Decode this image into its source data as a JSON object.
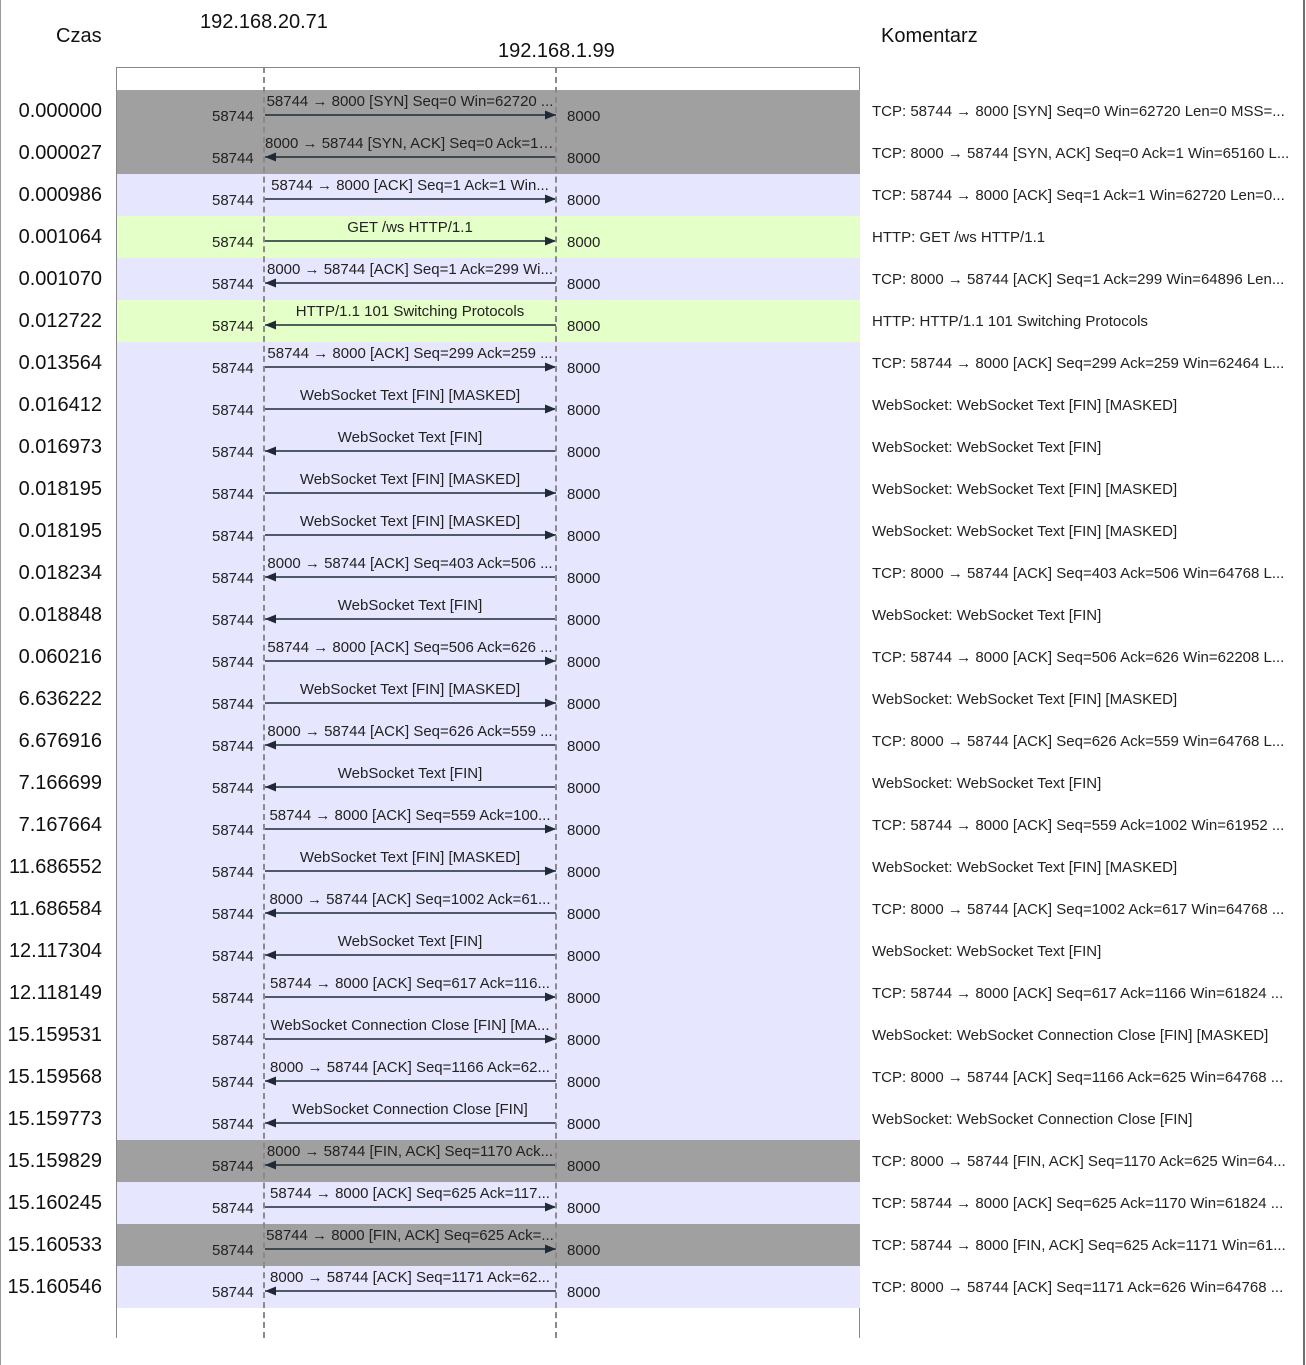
{
  "headers": {
    "time": "Czas",
    "host_a": "192.168.20.71",
    "host_b": "192.168.1.99",
    "comment": "Komentarz"
  },
  "colors": {
    "tcp_handshake": "#a0a0a0",
    "tcp": "#e7e6ff",
    "http": "#e4ffc7",
    "websocket": "#e7e6ff"
  },
  "rows": [
    {
      "time": "0.000000",
      "port_a": "58744",
      "port_b": "8000",
      "dir": "right",
      "label": "58744 → 8000 [SYN] Seq=0 Win=62720 ...",
      "comment": "TCP: 58744 → 8000 [SYN] Seq=0 Win=62720 Len=0 MSS=...",
      "color": "#a0a0a0"
    },
    {
      "time": "0.000027",
      "port_a": "58744",
      "port_b": "8000",
      "dir": "left",
      "label": "8000 → 58744 [SYN, ACK] Seq=0 Ack=1 ...",
      "comment": "TCP: 8000 → 58744 [SYN, ACK] Seq=0 Ack=1 Win=65160 L...",
      "color": "#a0a0a0"
    },
    {
      "time": "0.000986",
      "port_a": "58744",
      "port_b": "8000",
      "dir": "right",
      "label": "58744 → 8000 [ACK] Seq=1 Ack=1 Win...",
      "comment": "TCP: 58744 → 8000 [ACK] Seq=1 Ack=1 Win=62720 Len=0...",
      "color": "#e7e6ff"
    },
    {
      "time": "0.001064",
      "port_a": "58744",
      "port_b": "8000",
      "dir": "right",
      "label": "GET /ws HTTP/1.1",
      "comment": "HTTP: GET /ws HTTP/1.1",
      "color": "#e4ffc7"
    },
    {
      "time": "0.001070",
      "port_a": "58744",
      "port_b": "8000",
      "dir": "left",
      "label": "8000 → 58744 [ACK] Seq=1 Ack=299 Wi...",
      "comment": "TCP: 8000 → 58744 [ACK] Seq=1 Ack=299 Win=64896 Len...",
      "color": "#e7e6ff"
    },
    {
      "time": "0.012722",
      "port_a": "58744",
      "port_b": "8000",
      "dir": "left",
      "label": "HTTP/1.1 101 Switching Protocols",
      "comment": "HTTP: HTTP/1.1 101 Switching Protocols",
      "color": "#e4ffc7"
    },
    {
      "time": "0.013564",
      "port_a": "58744",
      "port_b": "8000",
      "dir": "right",
      "label": "58744 → 8000 [ACK] Seq=299 Ack=259 ...",
      "comment": "TCP: 58744 → 8000 [ACK] Seq=299 Ack=259 Win=62464 L...",
      "color": "#e7e6ff"
    },
    {
      "time": "0.016412",
      "port_a": "58744",
      "port_b": "8000",
      "dir": "right",
      "label": "WebSocket Text [FIN] [MASKED]",
      "comment": "WebSocket: WebSocket Text [FIN] [MASKED]",
      "color": "#e7e6ff"
    },
    {
      "time": "0.016973",
      "port_a": "58744",
      "port_b": "8000",
      "dir": "left",
      "label": "WebSocket Text [FIN]",
      "comment": "WebSocket: WebSocket Text [FIN]",
      "color": "#e7e6ff"
    },
    {
      "time": "0.018195",
      "port_a": "58744",
      "port_b": "8000",
      "dir": "right",
      "label": "WebSocket Text [FIN] [MASKED]",
      "comment": "WebSocket: WebSocket Text [FIN] [MASKED]",
      "color": "#e7e6ff"
    },
    {
      "time": "0.018195",
      "port_a": "58744",
      "port_b": "8000",
      "dir": "right",
      "label": "WebSocket Text [FIN] [MASKED]",
      "comment": "WebSocket: WebSocket Text [FIN] [MASKED]",
      "color": "#e7e6ff"
    },
    {
      "time": "0.018234",
      "port_a": "58744",
      "port_b": "8000",
      "dir": "left",
      "label": "8000 → 58744 [ACK] Seq=403 Ack=506 ...",
      "comment": "TCP: 8000 → 58744 [ACK] Seq=403 Ack=506 Win=64768 L...",
      "color": "#e7e6ff"
    },
    {
      "time": "0.018848",
      "port_a": "58744",
      "port_b": "8000",
      "dir": "left",
      "label": "WebSocket Text [FIN]",
      "comment": "WebSocket: WebSocket Text [FIN]",
      "color": "#e7e6ff"
    },
    {
      "time": "0.060216",
      "port_a": "58744",
      "port_b": "8000",
      "dir": "right",
      "label": "58744 → 8000 [ACK] Seq=506 Ack=626 ...",
      "comment": "TCP: 58744 → 8000 [ACK] Seq=506 Ack=626 Win=62208 L...",
      "color": "#e7e6ff"
    },
    {
      "time": "6.636222",
      "port_a": "58744",
      "port_b": "8000",
      "dir": "right",
      "label": "WebSocket Text [FIN] [MASKED]",
      "comment": "WebSocket: WebSocket Text [FIN] [MASKED]",
      "color": "#e7e6ff"
    },
    {
      "time": "6.676916",
      "port_a": "58744",
      "port_b": "8000",
      "dir": "left",
      "label": "8000 → 58744 [ACK] Seq=626 Ack=559 ...",
      "comment": "TCP: 8000 → 58744 [ACK] Seq=626 Ack=559 Win=64768 L...",
      "color": "#e7e6ff"
    },
    {
      "time": "7.166699",
      "port_a": "58744",
      "port_b": "8000",
      "dir": "left",
      "label": "WebSocket Text [FIN]",
      "comment": "WebSocket: WebSocket Text [FIN]",
      "color": "#e7e6ff"
    },
    {
      "time": "7.167664",
      "port_a": "58744",
      "port_b": "8000",
      "dir": "right",
      "label": "58744 → 8000 [ACK] Seq=559 Ack=100...",
      "comment": "TCP: 58744 → 8000 [ACK] Seq=559 Ack=1002 Win=61952 ...",
      "color": "#e7e6ff"
    },
    {
      "time": "11.686552",
      "port_a": "58744",
      "port_b": "8000",
      "dir": "right",
      "label": "WebSocket Text [FIN] [MASKED]",
      "comment": "WebSocket: WebSocket Text [FIN] [MASKED]",
      "color": "#e7e6ff"
    },
    {
      "time": "11.686584",
      "port_a": "58744",
      "port_b": "8000",
      "dir": "left",
      "label": "8000 → 58744 [ACK] Seq=1002 Ack=61...",
      "comment": "TCP: 8000 → 58744 [ACK] Seq=1002 Ack=617 Win=64768 ...",
      "color": "#e7e6ff"
    },
    {
      "time": "12.117304",
      "port_a": "58744",
      "port_b": "8000",
      "dir": "left",
      "label": "WebSocket Text [FIN]",
      "comment": "WebSocket: WebSocket Text [FIN]",
      "color": "#e7e6ff"
    },
    {
      "time": "12.118149",
      "port_a": "58744",
      "port_b": "8000",
      "dir": "right",
      "label": "58744 → 8000 [ACK] Seq=617 Ack=116...",
      "comment": "TCP: 58744 → 8000 [ACK] Seq=617 Ack=1166 Win=61824 ...",
      "color": "#e7e6ff"
    },
    {
      "time": "15.159531",
      "port_a": "58744",
      "port_b": "8000",
      "dir": "right",
      "label": "WebSocket Connection Close [FIN] [MA...",
      "comment": "WebSocket: WebSocket Connection Close [FIN] [MASKED]",
      "color": "#e7e6ff"
    },
    {
      "time": "15.159568",
      "port_a": "58744",
      "port_b": "8000",
      "dir": "left",
      "label": "8000 → 58744 [ACK] Seq=1166 Ack=62...",
      "comment": "TCP: 8000 → 58744 [ACK] Seq=1166 Ack=625 Win=64768 ...",
      "color": "#e7e6ff"
    },
    {
      "time": "15.159773",
      "port_a": "58744",
      "port_b": "8000",
      "dir": "left",
      "label": "WebSocket Connection Close [FIN]",
      "comment": "WebSocket: WebSocket Connection Close [FIN]",
      "color": "#e7e6ff"
    },
    {
      "time": "15.159829",
      "port_a": "58744",
      "port_b": "8000",
      "dir": "left",
      "label": "8000 → 58744 [FIN, ACK] Seq=1170 Ack...",
      "comment": "TCP: 8000 → 58744 [FIN, ACK] Seq=1170 Ack=625 Win=64...",
      "color": "#a0a0a0"
    },
    {
      "time": "15.160245",
      "port_a": "58744",
      "port_b": "8000",
      "dir": "right",
      "label": "58744 → 8000 [ACK] Seq=625 Ack=117...",
      "comment": "TCP: 58744 → 8000 [ACK] Seq=625 Ack=1170 Win=61824 ...",
      "color": "#e7e6ff"
    },
    {
      "time": "15.160533",
      "port_a": "58744",
      "port_b": "8000",
      "dir": "right",
      "label": "58744 → 8000 [FIN, ACK] Seq=625 Ack=...",
      "comment": "TCP: 58744 → 8000 [FIN, ACK] Seq=625 Ack=1171 Win=61...",
      "color": "#a0a0a0"
    },
    {
      "time": "15.160546",
      "port_a": "58744",
      "port_b": "8000",
      "dir": "left",
      "label": "8000 → 58744 [ACK] Seq=1171 Ack=62...",
      "comment": "TCP: 8000 → 58744 [ACK] Seq=1171 Ack=626 Win=64768 ...",
      "color": "#e7e6ff"
    }
  ]
}
